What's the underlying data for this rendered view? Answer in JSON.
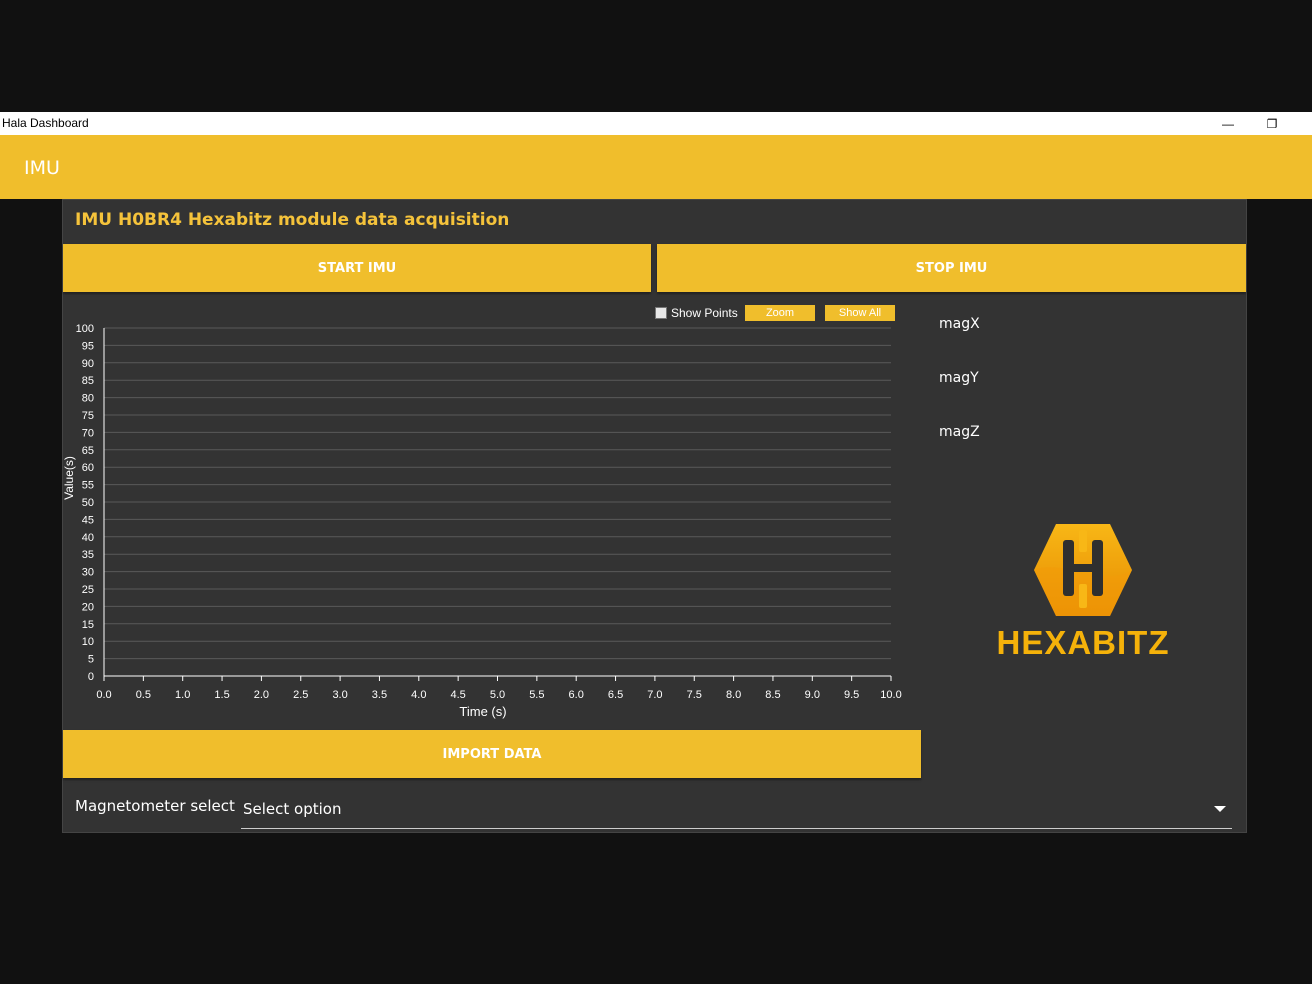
{
  "window": {
    "title": "Hala Dashboard",
    "minimize_glyph": "—",
    "restore_glyph": "❐"
  },
  "appbar": {
    "title": "IMU"
  },
  "main": {
    "heading": "IMU H0BR4 Hexabitz module data acquisition",
    "start_label": "START IMU",
    "stop_label": "STOP IMU",
    "import_label": "IMPORT DATA"
  },
  "chart_controls": {
    "show_points_label": "Show Points",
    "show_points_checked": false,
    "zoom_label": "Zoom",
    "show_all_label": "Show All"
  },
  "legend": [
    "magX",
    "magY",
    "magZ"
  ],
  "logo": {
    "text": "HEXABITZ",
    "icon": "hexabitz-logo-icon"
  },
  "magnetometer": {
    "label": "Magnetometer select",
    "placeholder": "Select option"
  },
  "colors": {
    "accent": "#f0be2c",
    "panel": "#333333",
    "background": "#111111"
  },
  "chart_data": {
    "type": "line",
    "title": "",
    "xlabel": "Time (s)",
    "ylabel": "Value(s)",
    "xlim": [
      0,
      10
    ],
    "ylim": [
      0,
      100
    ],
    "x_ticks": [
      "0.0",
      "0.5",
      "1.0",
      "1.5",
      "2.0",
      "2.5",
      "3.0",
      "3.5",
      "4.0",
      "4.5",
      "5.0",
      "5.5",
      "6.0",
      "6.5",
      "7.0",
      "7.5",
      "8.0",
      "8.5",
      "9.0",
      "9.5",
      "10.0"
    ],
    "y_ticks": [
      "0",
      "5",
      "10",
      "15",
      "20",
      "25",
      "30",
      "35",
      "40",
      "45",
      "50",
      "55",
      "60",
      "65",
      "70",
      "75",
      "80",
      "85",
      "90",
      "95",
      "100"
    ],
    "grid": true,
    "series": []
  }
}
